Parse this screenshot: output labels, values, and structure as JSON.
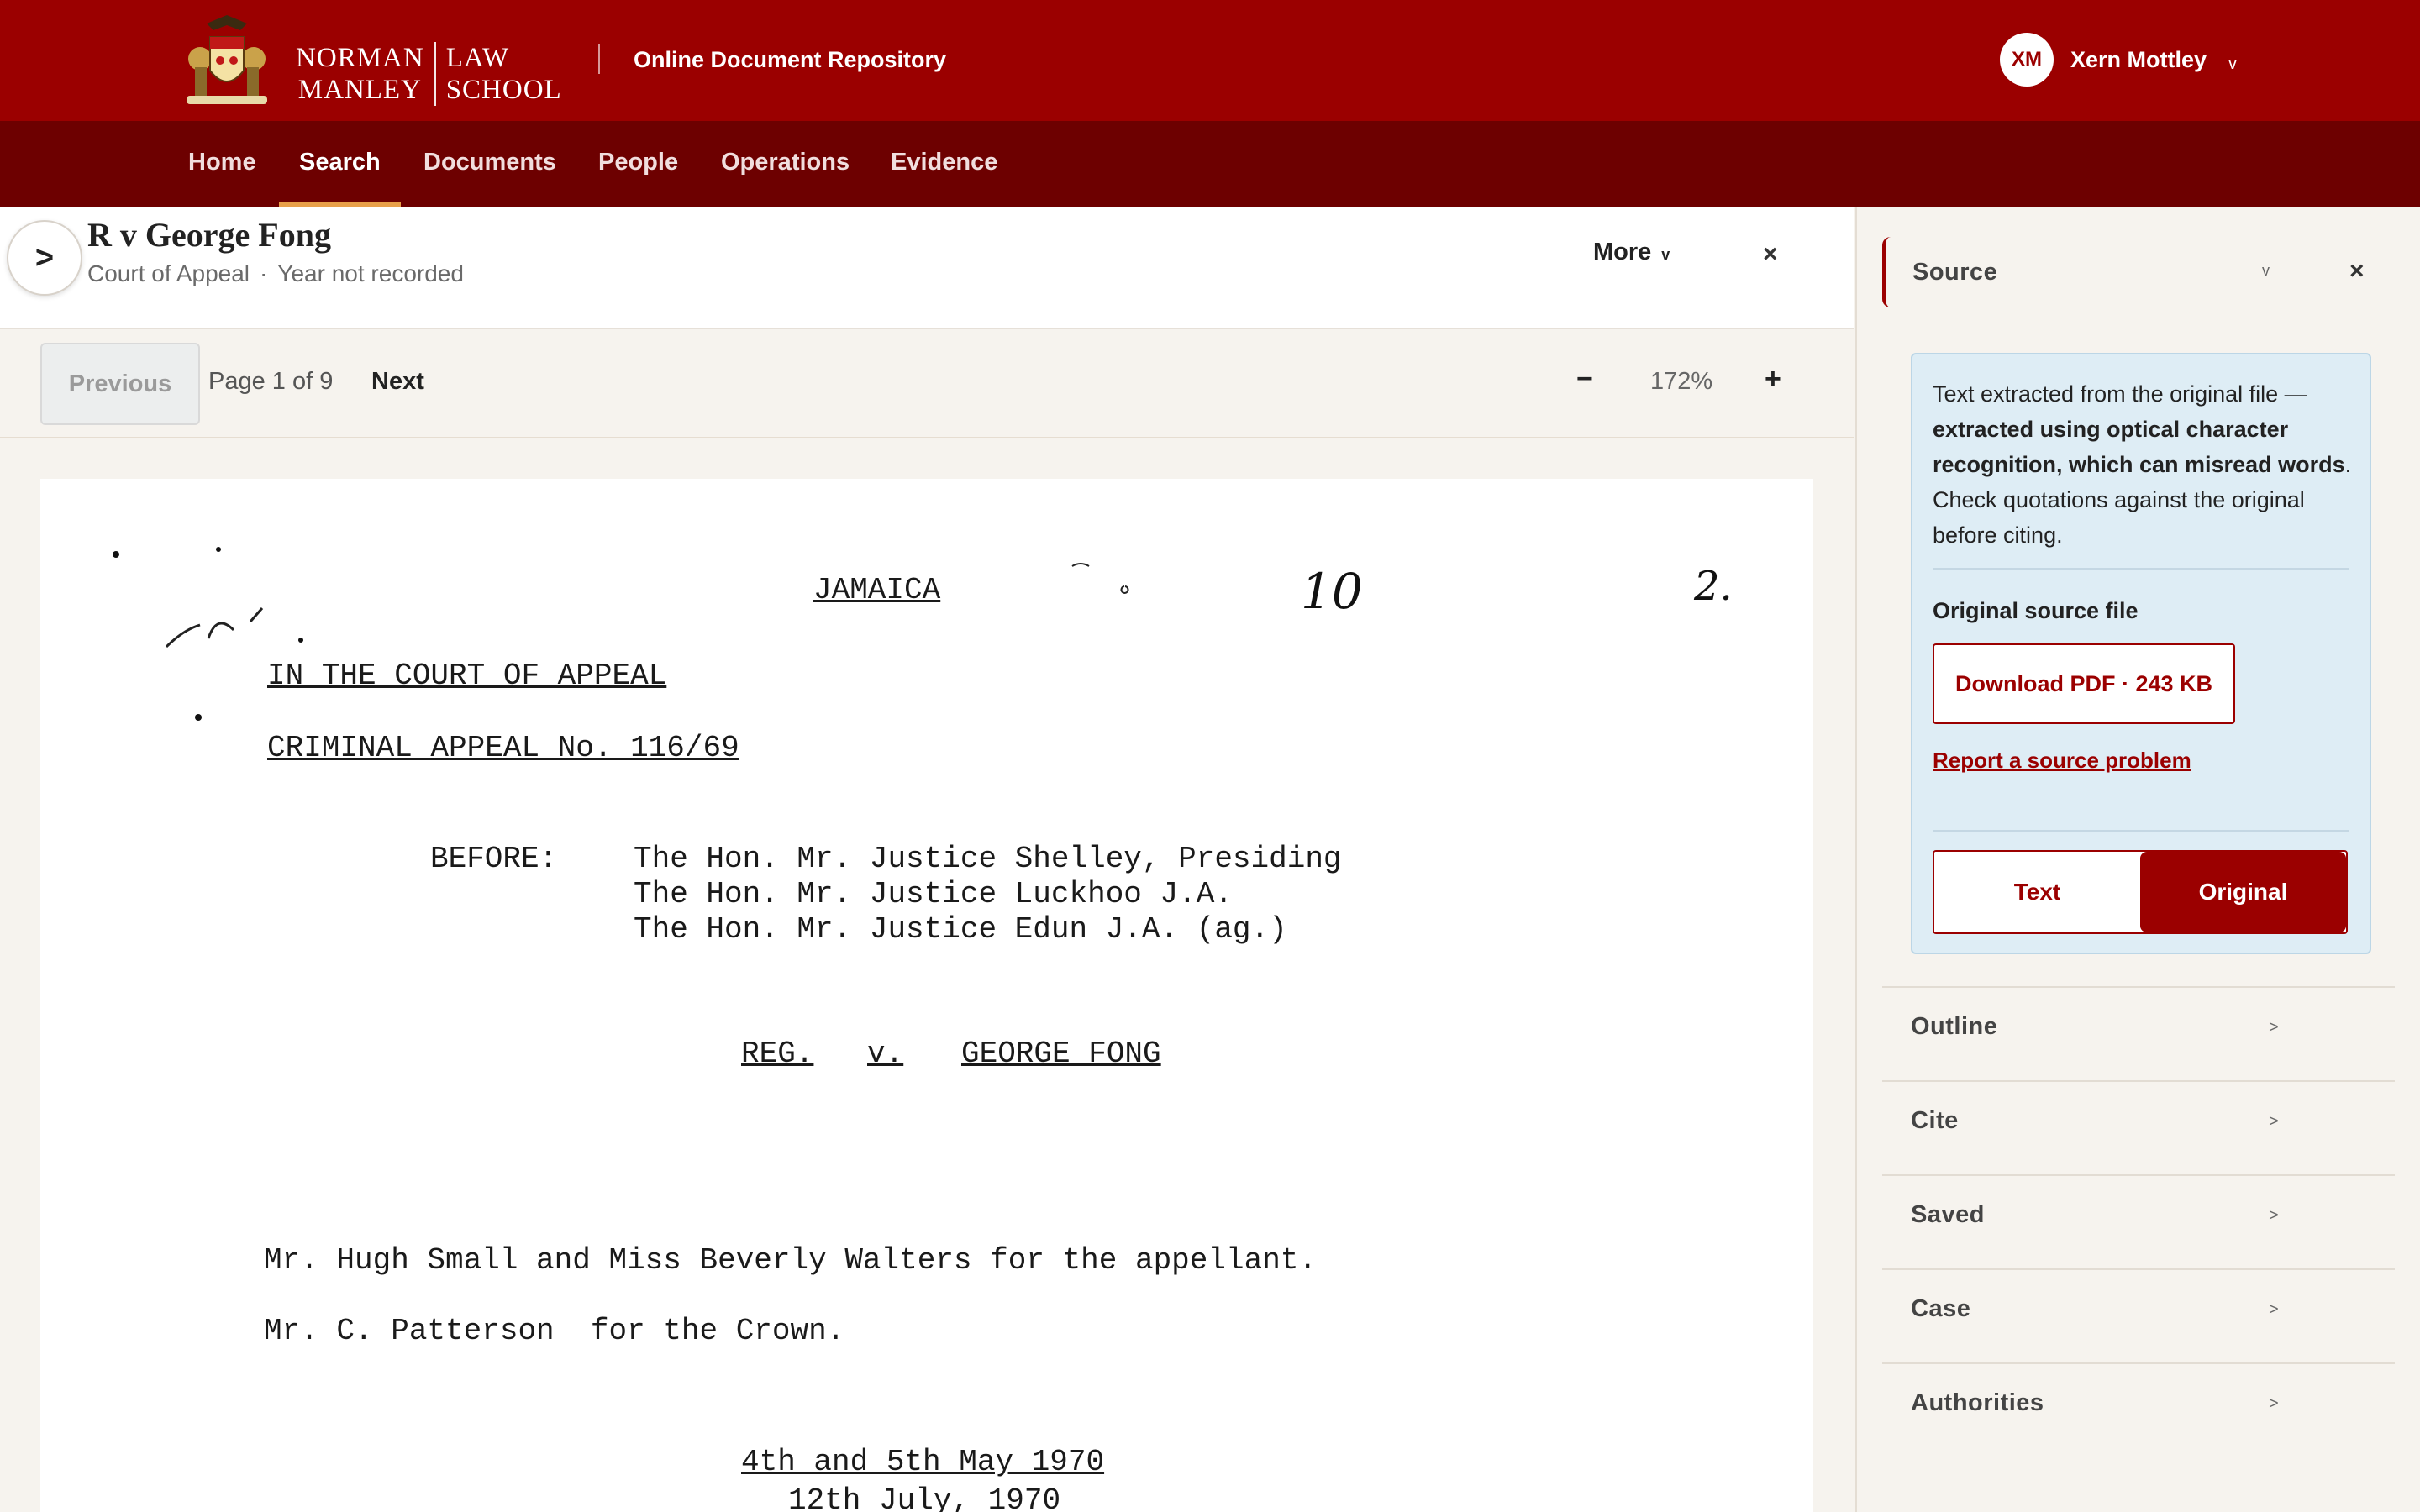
{
  "header": {
    "school_line1_left": "NORMAN",
    "school_line2_left": "MANLEY",
    "school_line1_right": "LAW",
    "school_line2_right": "SCHOOL",
    "repository_title": "Online Document Repository",
    "user_initials": "XM",
    "user_name": "Xern Mottley",
    "user_caret": "v"
  },
  "nav": {
    "items": [
      {
        "label": "Home"
      },
      {
        "label": "Search"
      },
      {
        "label": "Documents"
      },
      {
        "label": "People"
      },
      {
        "label": "Operations"
      },
      {
        "label": "Evidence"
      }
    ],
    "active": "Search"
  },
  "doc": {
    "expand_icon": ">",
    "title": "R v George Fong",
    "court": "Court of Appeal",
    "separator": "·",
    "year": "Year not recorded",
    "more_label": "More",
    "more_caret": "v",
    "close_icon": "×"
  },
  "pager": {
    "previous": "Previous",
    "page_indicator": "Page 1 of 9",
    "next": "Next",
    "zoom_out": "−",
    "zoom_level": "172%",
    "zoom_in": "+"
  },
  "page_text": {
    "handwritten_1": "10",
    "handwritten_2": "2.",
    "jamaica": "JAMAICA",
    "court": "IN THE COURT OF APPEAL",
    "appeal_no": "CRIMINAL APPEAL No. 116/69",
    "before": "BEFORE:",
    "judge_1": "The Hon. Mr. Justice Shelley, Presiding",
    "judge_2": "The Hon. Mr. Justice Luckhoo J.A.",
    "judge_3": "The Hon. Mr. Justice Edun J.A. (ag.)",
    "case_reg": "REG.",
    "case_v": "v.",
    "case_name": "GEORGE FONG",
    "counsel_appellant": "Mr. Hugh Small and Miss Beverly Walters for the appellant.",
    "counsel_crown": "Mr. C. Patterson  for the Crown.",
    "hearing_dates": "4th and 5th May 1970",
    "judgment_date": "12th July, 1970"
  },
  "side_panel": {
    "source_label": "Source",
    "source_chevron": "v",
    "source_close": "×",
    "ocr_note_lead": "Text extracted from the original file — ",
    "ocr_note_bold": "extracted using optical character recognition, which can misread words",
    "ocr_note_tail": ". Check quotations against the original before citing.",
    "original_source_label": "Original source file",
    "download_label": "Download PDF · 243 KB",
    "report_link": "Report a source problem",
    "toggle_text": "Text",
    "toggle_original": "Original",
    "toggle_selected": "Original",
    "sections": [
      {
        "label": "Outline",
        "arrow": ">"
      },
      {
        "label": "Cite",
        "arrow": ">"
      },
      {
        "label": "Saved",
        "arrow": ">"
      },
      {
        "label": "Case",
        "arrow": ">"
      },
      {
        "label": "Authorities",
        "arrow": ">"
      }
    ]
  },
  "colors": {
    "brand": "#9b0000",
    "nav_bg": "#6d0000",
    "active_tab_underline": "#e8a04a",
    "info_box_bg": "#deedf5"
  },
  "icons": {
    "crest": "school-crest-icon",
    "expand": "chevron-right-icon",
    "close": "close-icon",
    "zoom_out": "minus-icon",
    "zoom_in": "plus-icon"
  }
}
